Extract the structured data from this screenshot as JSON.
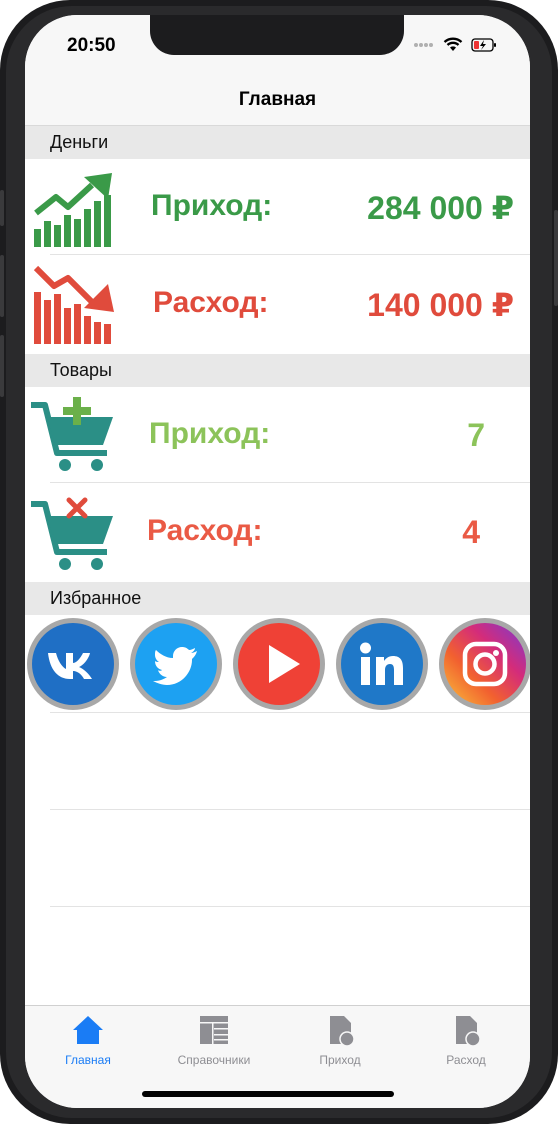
{
  "status": {
    "time": "20:50"
  },
  "nav": {
    "title": "Главная"
  },
  "sections": {
    "money": "Деньги",
    "goods": "Товары",
    "favorites": "Избранное"
  },
  "money": {
    "income": {
      "label": "Приход:",
      "value": "284 000 ₽",
      "color": "#3a9a48"
    },
    "expense": {
      "label": "Расход:",
      "value": "140 000 ₽",
      "color": "#e04b3c"
    }
  },
  "goods": {
    "income": {
      "label": "Приход:",
      "value": "7",
      "color": "#8cc35a"
    },
    "expense": {
      "label": "Расход:",
      "value": "4",
      "color": "#ea5a45"
    }
  },
  "favorites": [
    "vk-icon",
    "twitter-icon",
    "youtube-icon",
    "linkedin-icon",
    "instagram-icon"
  ],
  "tabs": [
    {
      "label": "Главная",
      "icon": "home-icon",
      "active": true
    },
    {
      "label": "Справочники",
      "icon": "table-icon",
      "active": false
    },
    {
      "label": "Приход",
      "icon": "document-icon",
      "active": false
    },
    {
      "label": "Расход",
      "icon": "document-icon",
      "active": false
    }
  ],
  "colors": {
    "accent": "#1a7cf5",
    "inactive": "#8e8e93"
  }
}
